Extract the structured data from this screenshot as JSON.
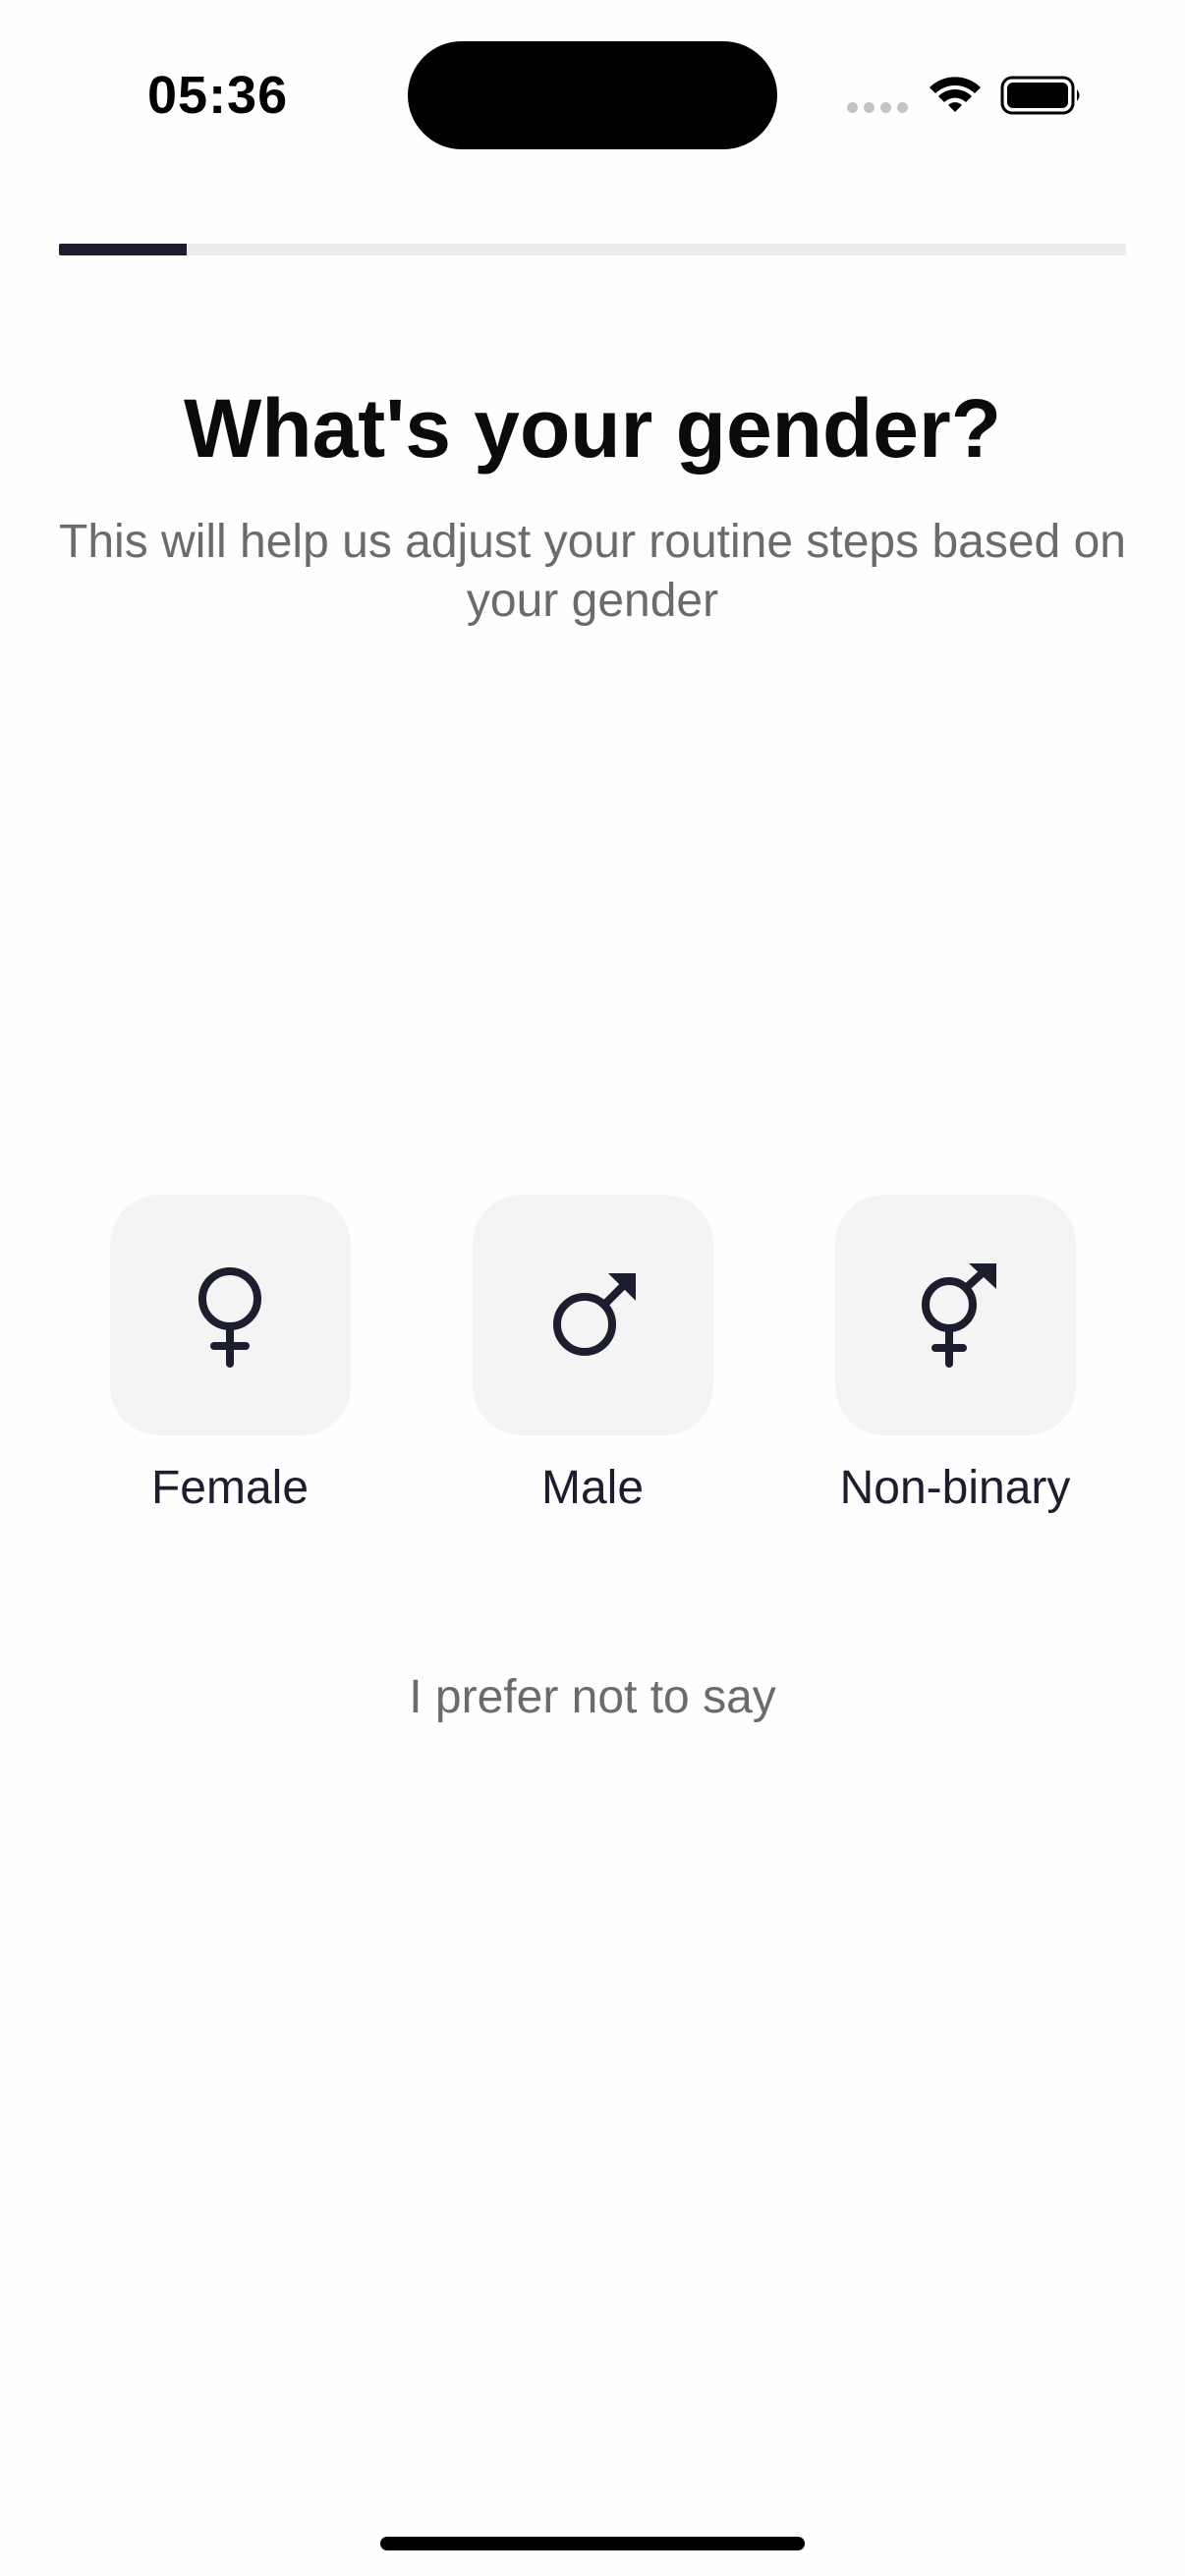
{
  "status_bar": {
    "time": "05:36",
    "icons": [
      "signal-dots-icon",
      "wifi-icon",
      "battery-icon"
    ]
  },
  "progress": {
    "fraction": 0.12,
    "color": "#1c1d2e",
    "track_color": "#ececec"
  },
  "header": {
    "title": "What's your gender?",
    "subtitle": "This will help us adjust your routine steps based on your gender"
  },
  "options": [
    {
      "label": "Female",
      "icon": "female-symbol-icon"
    },
    {
      "label": "Male",
      "icon": "male-symbol-icon"
    },
    {
      "label": "Non-binary",
      "icon": "non-binary-symbol-icon"
    }
  ],
  "prefer_not_label": "I prefer not to say",
  "colors": {
    "accent": "#1c1d2e",
    "tile_bg": "#f4f4f5",
    "muted_text": "#6b6b6e"
  }
}
